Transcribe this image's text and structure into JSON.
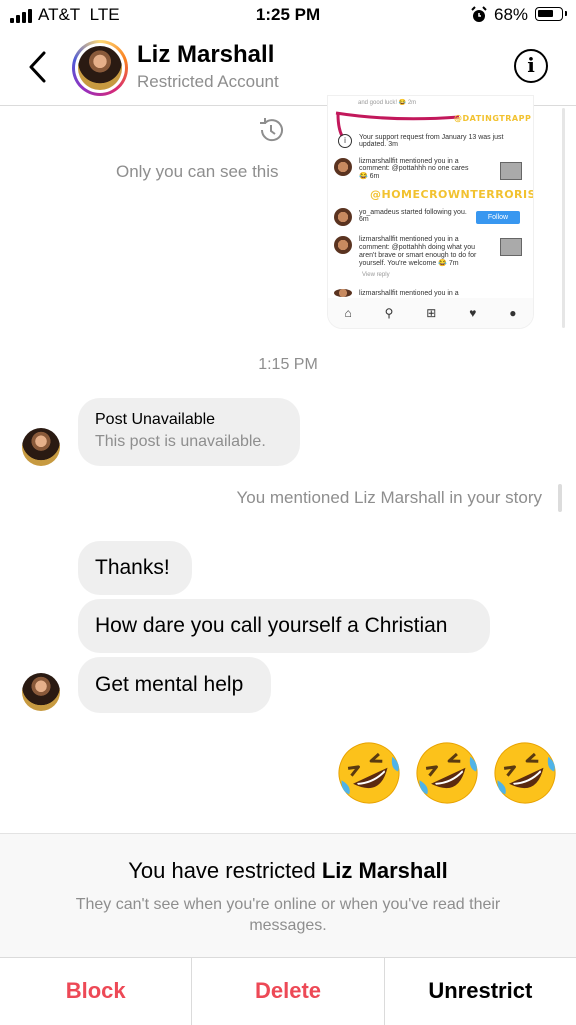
{
  "status_bar": {
    "carrier": "AT&T",
    "network": "LTE",
    "time": "1:25 PM",
    "battery_percent": "68%",
    "battery_level": 0.68
  },
  "header": {
    "name": "Liz Marshall",
    "subtitle": "Restricted Account"
  },
  "shared_screenshot": {
    "caption": "Only you can see this",
    "lines": {
      "partial_top": "and good luck! 😂 2m",
      "tag_top": "@DATINGTRAPP",
      "support": "Your support request from January 13 was just updated. 3m",
      "mention1": "lizmarshallfit mentioned you in a comment: @pottahhh no one cares 😂 6m",
      "tag_mid": "@HOMECROWNTERRORISTS",
      "follow_text": "yo_amadeus started following you. 6m",
      "follow_btn": "Follow",
      "mention2": "lizmarshallfit mentioned you in a comment: @pottahhh doing what you aren't brave or smart enough to do for yourself. You're welcome 😂 7m",
      "view_reply": "View reply",
      "mention3": "lizmarshallfit mentioned you in a"
    }
  },
  "timestamp": "1:15 PM",
  "post": {
    "title": "Post Unavailable",
    "subtitle": "This post is unavailable."
  },
  "story_mention": "You mentioned Liz Marshall in your story",
  "messages": [
    "Thanks!",
    "How dare you call yourself a Christian",
    "Get mental help"
  ],
  "emojis": [
    "rofl-emoji",
    "rofl-emoji",
    "rofl-emoji"
  ],
  "restriction": {
    "prefix": "You have restricted ",
    "name": "Liz Marshall",
    "description": "They can't see when you're online or when you've read their messages."
  },
  "actions": {
    "block": "Block",
    "delete": "Delete",
    "unrestrict": "Unrestrict"
  },
  "colors": {
    "danger": "#ed4956",
    "muted": "#8e8e8e",
    "bubble": "#efefef"
  }
}
